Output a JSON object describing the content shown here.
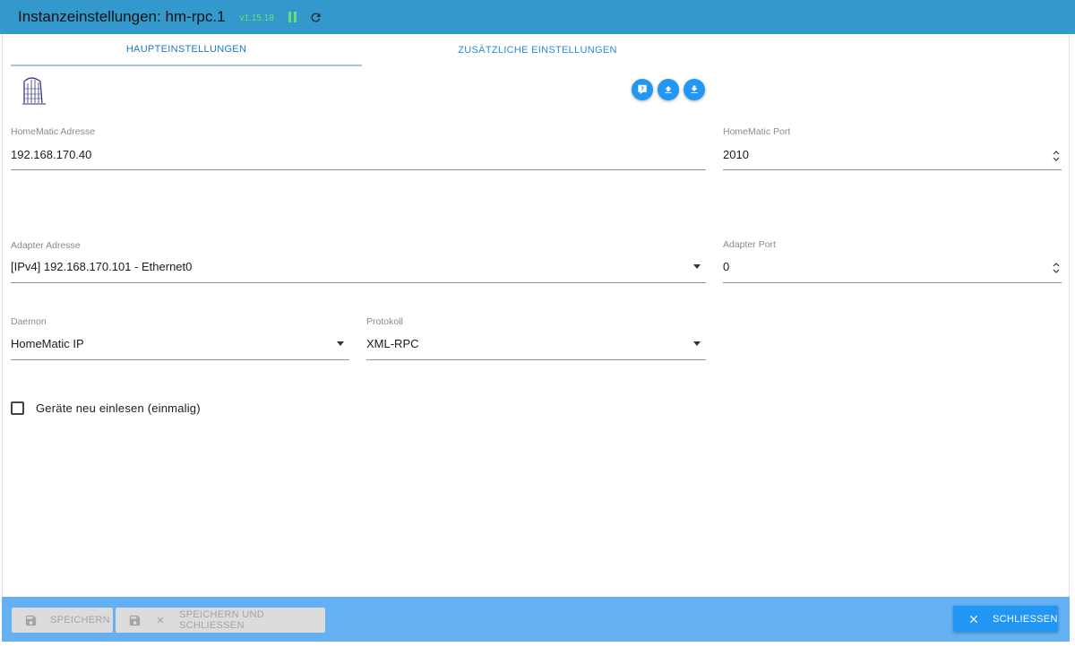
{
  "window": {
    "title": "Instanzeinstellungen: hm-rpc.1",
    "version": "v1.15.18"
  },
  "tabs": [
    {
      "label": "HAUPTEINSTELLUNGEN",
      "active": true
    },
    {
      "label": "ZUSÄTZLICHE EINSTELLUNGEN",
      "active": false
    }
  ],
  "logo": {
    "text": "HomeMatic"
  },
  "fields": {
    "homematic_address": {
      "label": "HomeMatic Adresse",
      "value": "192.168.170.40"
    },
    "homematic_port": {
      "label": "HomeMatic Port",
      "value": "2010"
    },
    "adapter_address": {
      "label": "Adapter Adresse",
      "value": "[IPv4] 192.168.170.101 - Ethernet0"
    },
    "adapter_port": {
      "label": "Adapter Port",
      "value": "0"
    },
    "daemon": {
      "label": "Daemon",
      "value": "HomeMatic IP"
    },
    "protocol": {
      "label": "Protokoll",
      "value": "XML-RPC"
    }
  },
  "checkbox": {
    "label": "Geräte neu einlesen (einmalig)",
    "checked": false
  },
  "footer": {
    "save_label": "SPEICHERN",
    "save_close_label": "SPEICHERN UND SCHLIESSEN",
    "close_label": "SCHLIESSEN"
  },
  "colors": {
    "titlebar": "#3399cc",
    "accent": "#2196f3",
    "footer": "#64b0f2",
    "status_green": "#6fdc6f"
  },
  "icons": {
    "status": "pause-icon",
    "reload": "reload-icon",
    "help": "help-icon",
    "upload": "upload-icon",
    "download": "download-icon",
    "save": "floppy-disk-icon",
    "close": "close-icon"
  }
}
